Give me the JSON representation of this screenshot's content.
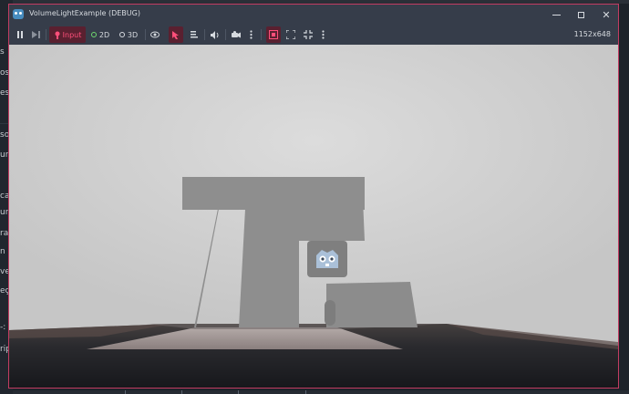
{
  "background_editor": {
    "fragments": [
      "s",
      "os",
      "es",
      "so",
      "ur",
      "ca",
      "ur",
      "ra",
      "n",
      "ve",
      "eç",
      "-:",
      "rip"
    ]
  },
  "window": {
    "title": "VolumeLightExample (DEBUG)",
    "controls": {
      "minimize_icon": "minimize-icon",
      "maximize_icon": "maximize-icon",
      "close_icon": "close-icon",
      "close_glyph": "✕"
    }
  },
  "toolbar": {
    "pause_icon": "pause-icon",
    "next_frame_icon": "next-frame-icon",
    "input_label": "Input",
    "mode_2d_label": "2D",
    "mode_3d_label": "3D",
    "visibility_icon": "eye-icon",
    "select_icon": "cursor-select-icon",
    "list_icon": "list-icon",
    "audio_icon": "speaker-icon",
    "camera_override_icon": "camera-icon",
    "more_icon": "vertical-dots-icon",
    "frame_icon": "frame-select-icon",
    "expand_icon": "expand-icon",
    "collapse_icon": "collapse-icon",
    "more_icon_2": "vertical-dots-icon",
    "resolution": "1152x648"
  },
  "colors": {
    "accent": "#c23c62",
    "input_active": "#ff4f7a",
    "active_bg": "#5a2030",
    "mode_2d_indicator": "#6fd86f",
    "godot_blue": "#478cbf"
  },
  "viewport": {
    "logo_icon": "godot-logo-icon"
  }
}
